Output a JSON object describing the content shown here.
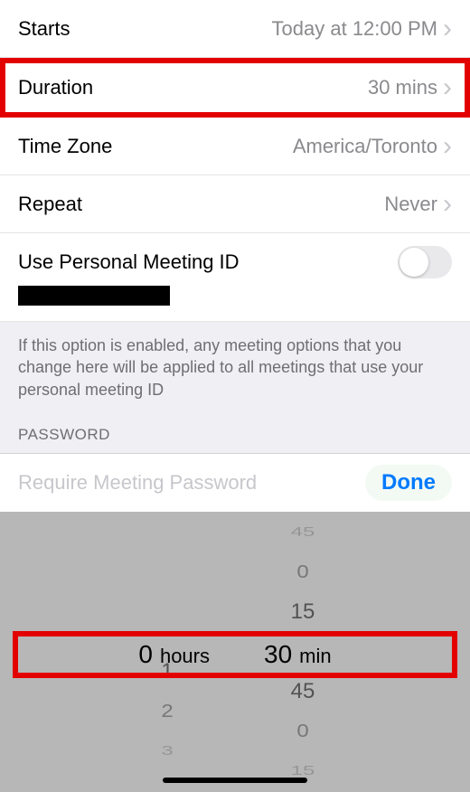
{
  "rows": {
    "starts": {
      "label": "Starts",
      "value": "Today at 12:00 PM"
    },
    "duration": {
      "label": "Duration",
      "value": "30 mins"
    },
    "timezone": {
      "label": "Time Zone",
      "value": "America/Toronto"
    },
    "repeat": {
      "label": "Repeat",
      "value": "Never"
    }
  },
  "pmi": {
    "label": "Use Personal Meeting ID",
    "enabled": false,
    "note": "If this option is enabled, any meeting options that you change here will be applied to all meetings that use your personal meeting ID"
  },
  "password": {
    "section": "PASSWORD",
    "require_label": "Require Meeting Password",
    "done_label": "Done"
  },
  "picker": {
    "hours_label": "hours",
    "min_label": "min",
    "selected_hours": "0",
    "selected_min": "30",
    "hours_below1": "1",
    "hours_below2": "2",
    "hours_below3": "3",
    "min_above2": "45",
    "min_above1": "15",
    "min_above1b": "0",
    "min_below1": "45",
    "min_below2": "0",
    "min_below3": "15"
  }
}
